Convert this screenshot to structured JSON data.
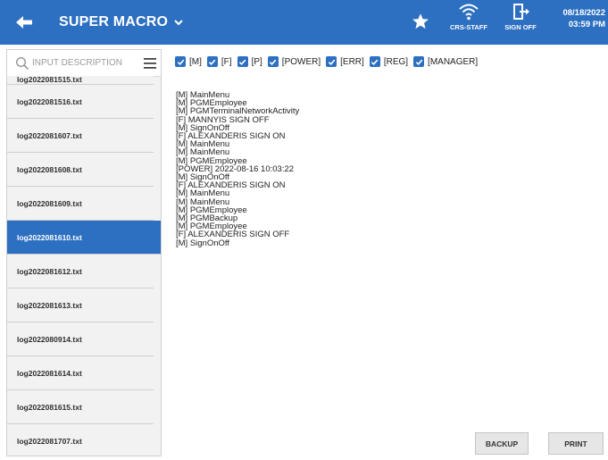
{
  "header": {
    "title": "SUPER MACRO",
    "wifi_label": "CRS-STAFF",
    "signoff_label": "SIGN OFF",
    "date": "08/18/2022",
    "time": "03:59 PM",
    "icons": [
      "back-arrow-icon",
      "chevron-down-icon",
      "star-icon",
      "wifi-icon",
      "sign-off-icon"
    ]
  },
  "colors": {
    "primary": "#2d6fc0",
    "panel_bg": "#f2f2f2",
    "text": "#222222"
  },
  "search": {
    "placeholder": "INPUT DESCRIPTION",
    "value": ""
  },
  "files": [
    {
      "name": "log2022081515.txt",
      "selected": false
    },
    {
      "name": "log2022081516.txt",
      "selected": false
    },
    {
      "name": "log2022081607.txt",
      "selected": false
    },
    {
      "name": "log2022081608.txt",
      "selected": false
    },
    {
      "name": "log2022081609.txt",
      "selected": false
    },
    {
      "name": "log2022081610.txt",
      "selected": true
    },
    {
      "name": "log2022081612.txt",
      "selected": false
    },
    {
      "name": "log2022081613.txt",
      "selected": false
    },
    {
      "name": "log2022080914.txt",
      "selected": false
    },
    {
      "name": "log2022081614.txt",
      "selected": false
    },
    {
      "name": "log2022081615.txt",
      "selected": false
    },
    {
      "name": "log2022081707.txt",
      "selected": false
    }
  ],
  "filters": [
    {
      "label": "[M]",
      "checked": true
    },
    {
      "label": "[F]",
      "checked": true
    },
    {
      "label": "[P]",
      "checked": true
    },
    {
      "label": "[POWER]",
      "checked": true
    },
    {
      "label": "[ERR]",
      "checked": true
    },
    {
      "label": "[REG]",
      "checked": true
    },
    {
      "label": "[MANAGER]",
      "checked": true
    }
  ],
  "log_lines": [
    "[M] MainMenu",
    "[M] PGMEmployee",
    "[M] PGMTerminalNetworkActivity",
    "[F] MANNYIS SIGN OFF",
    "[M] SignOnOff",
    "[F] ALEXANDERIS SIGN ON",
    "[M] MainMenu",
    "[M] MainMenu",
    "[M] PGMEmployee",
    "[POWER] 2022-08-16 10:03:22",
    "[M] SignOnOff",
    "[F] ALEXANDERIS SIGN ON",
    "[M] MainMenu",
    "[M] MainMenu",
    "[M] PGMEmployee",
    "[M] PGMBackup",
    "[M] PGMEmployee",
    "[F] ALEXANDERIS SIGN OFF",
    "[M] SignOnOff"
  ],
  "actions": {
    "backup_label": "BACKUP",
    "print_label": "PRINT"
  }
}
